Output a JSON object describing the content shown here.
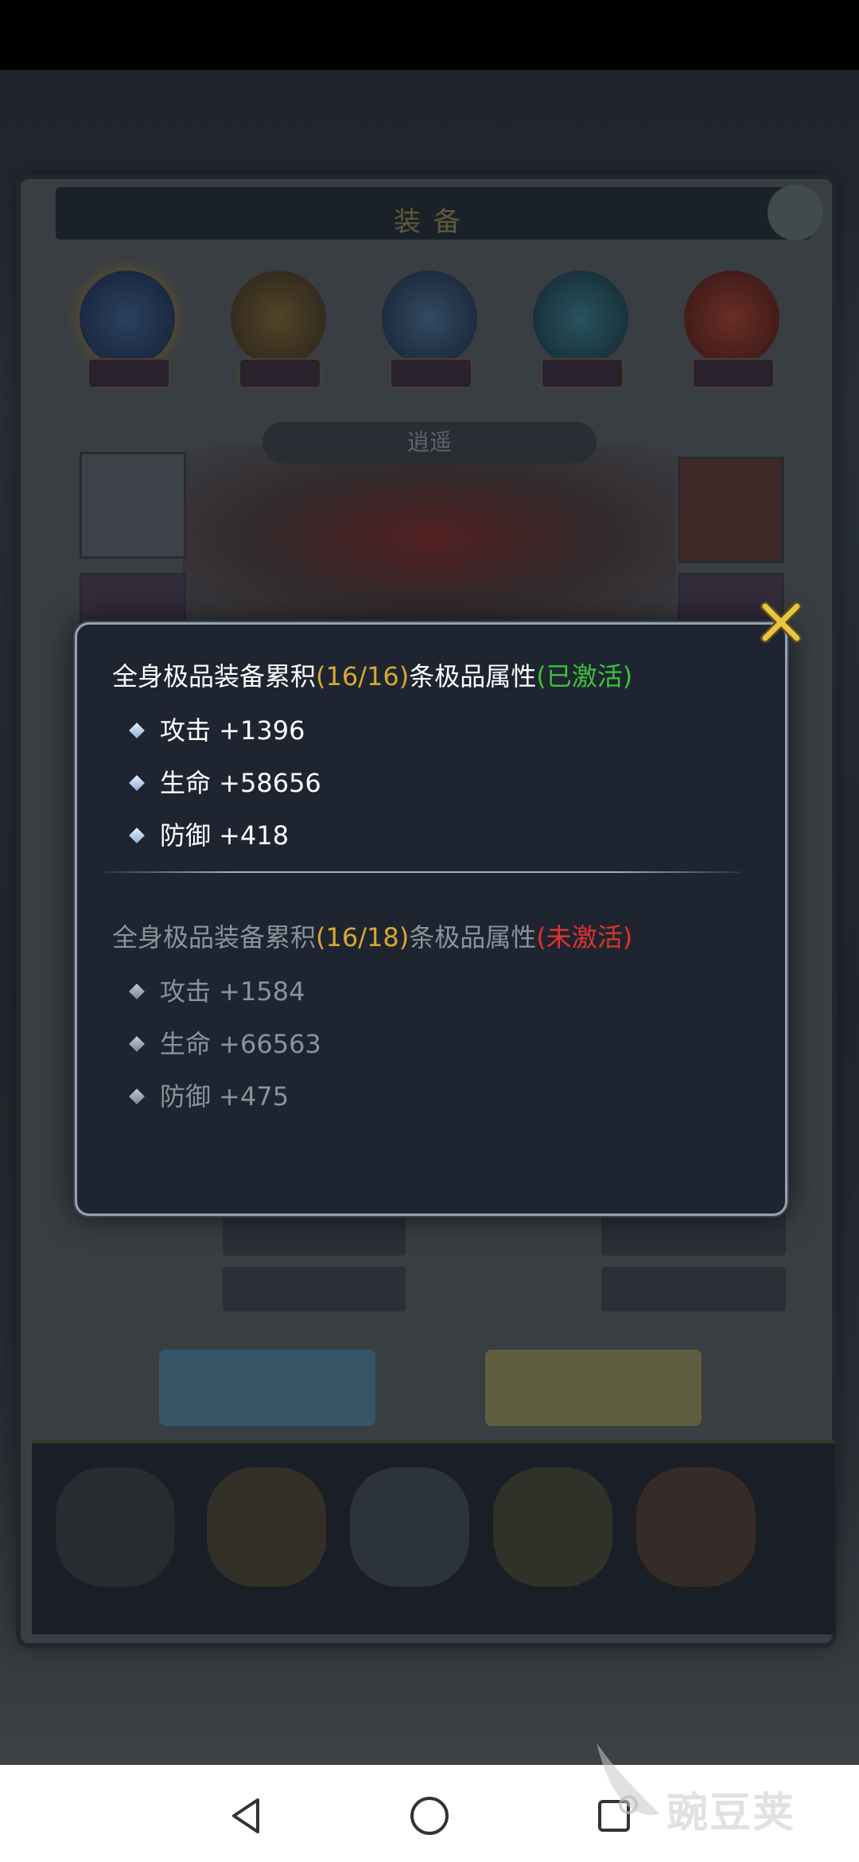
{
  "game": {
    "panel_title": "装备",
    "hero_name": "逍遥"
  },
  "popup": {
    "active": {
      "prefix": "全身极品装备累积",
      "count": "(16/16)",
      "suffix": "条极品属性",
      "status": "(已激活)",
      "stats": [
        {
          "label": "攻击 +1396"
        },
        {
          "label": "生命 +58656"
        },
        {
          "label": "防御 +418"
        }
      ]
    },
    "inactive": {
      "prefix": "全身极品装备累积",
      "count": "(16/18)",
      "suffix": "条极品属性",
      "status": "(未激活)",
      "stats": [
        {
          "label": "攻击 +1584"
        },
        {
          "label": "生命 +66563"
        },
        {
          "label": "防御 +475"
        }
      ]
    },
    "colors": {
      "active_text": "#ffffff",
      "count": "#d7a930",
      "active_status": "#3cc23c",
      "inactive_text": "#8b929c",
      "inactive_status": "#e0332d",
      "close": "#e8c542"
    }
  },
  "watermark": {
    "text": "豌豆荚"
  },
  "navbar": {
    "back": "back-icon",
    "home": "home-icon",
    "recents": "recents-icon"
  }
}
